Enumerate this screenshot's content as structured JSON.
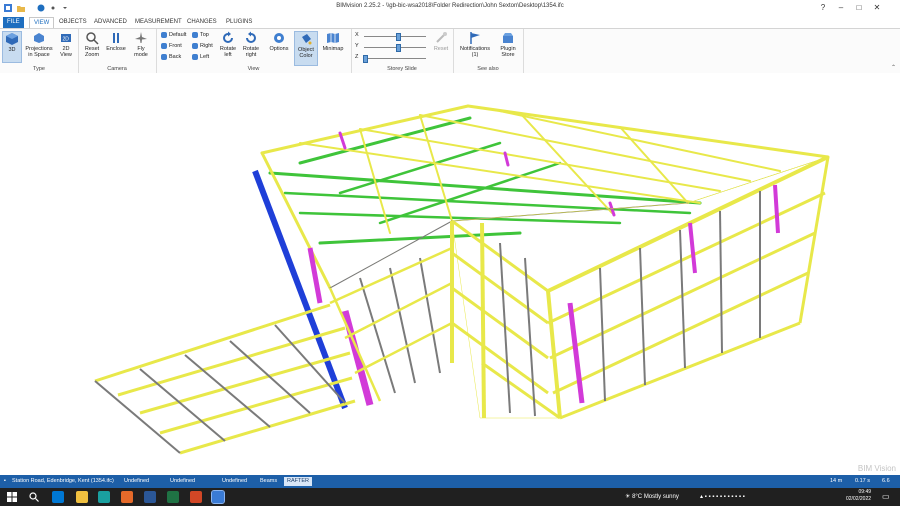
{
  "window": {
    "title": "BIMvision 2.25.2 - \\\\gb-bic-wsa2018\\Folder Redirection\\John Sexton\\Desktop\\1354.ifc",
    "help": "?",
    "minimize": "–",
    "maximize": "□",
    "close": "✕"
  },
  "tabs": [
    "FILE",
    "VIEW",
    "OBJECTS",
    "ADVANCED",
    "MEASUREMENT",
    "CHANGES",
    "PLUGINS"
  ],
  "ribbon": {
    "type_group": {
      "label": "Type",
      "btn_3d": "3D",
      "btn_projections": "Projections in Space",
      "btn_2d": "2D View"
    },
    "camera_group": {
      "label": "Camera",
      "btn_reset_zoom": "Reset Zoom",
      "btn_enclose": "Enclose",
      "btn_fly": "Fly mode"
    },
    "view_group": {
      "label": "View",
      "default": "Default",
      "front": "Front",
      "back": "Back",
      "top": "Top",
      "right": "Right",
      "left": "Left",
      "rotate_left": "Rotate left",
      "rotate_right": "Rotate right",
      "options": "Options",
      "object_color": "Object Color",
      "minimap": "Minimap"
    },
    "storey_group": {
      "label": "Storey Slide",
      "x": "X",
      "y": "Y",
      "z": "Z",
      "reset": "Reset",
      "x_value": 0.55,
      "y_value": 0.55,
      "z_value": 0.02
    },
    "see_also_group": {
      "label": "See also",
      "notifications": "Notifications (1)",
      "plugin_store": "Plugin Store"
    }
  },
  "viewport": {
    "watermark": "BIM Vision"
  },
  "statusbar": {
    "items": [
      "Station Road, Edenbridge, Kent (1354.ifc)",
      "Undefined",
      "Undefined",
      "Undefined",
      "Beams",
      "RAFTER"
    ],
    "scale": "14 m",
    "time": "0.17 s",
    "fps": "6.6"
  },
  "taskbar": {
    "weather_temp": "8°C",
    "weather_text": "Mostly sunny",
    "clock_time": "09:49",
    "clock_date": "02/02/2022"
  },
  "colors": {
    "accent": "#1e6ebf",
    "beam_yellow": "#e8e84a",
    "beam_green": "#3fc43a",
    "beam_magenta": "#d23ad8",
    "beam_blue": "#1f3fd8",
    "beam_grey": "#7a7a7a"
  }
}
